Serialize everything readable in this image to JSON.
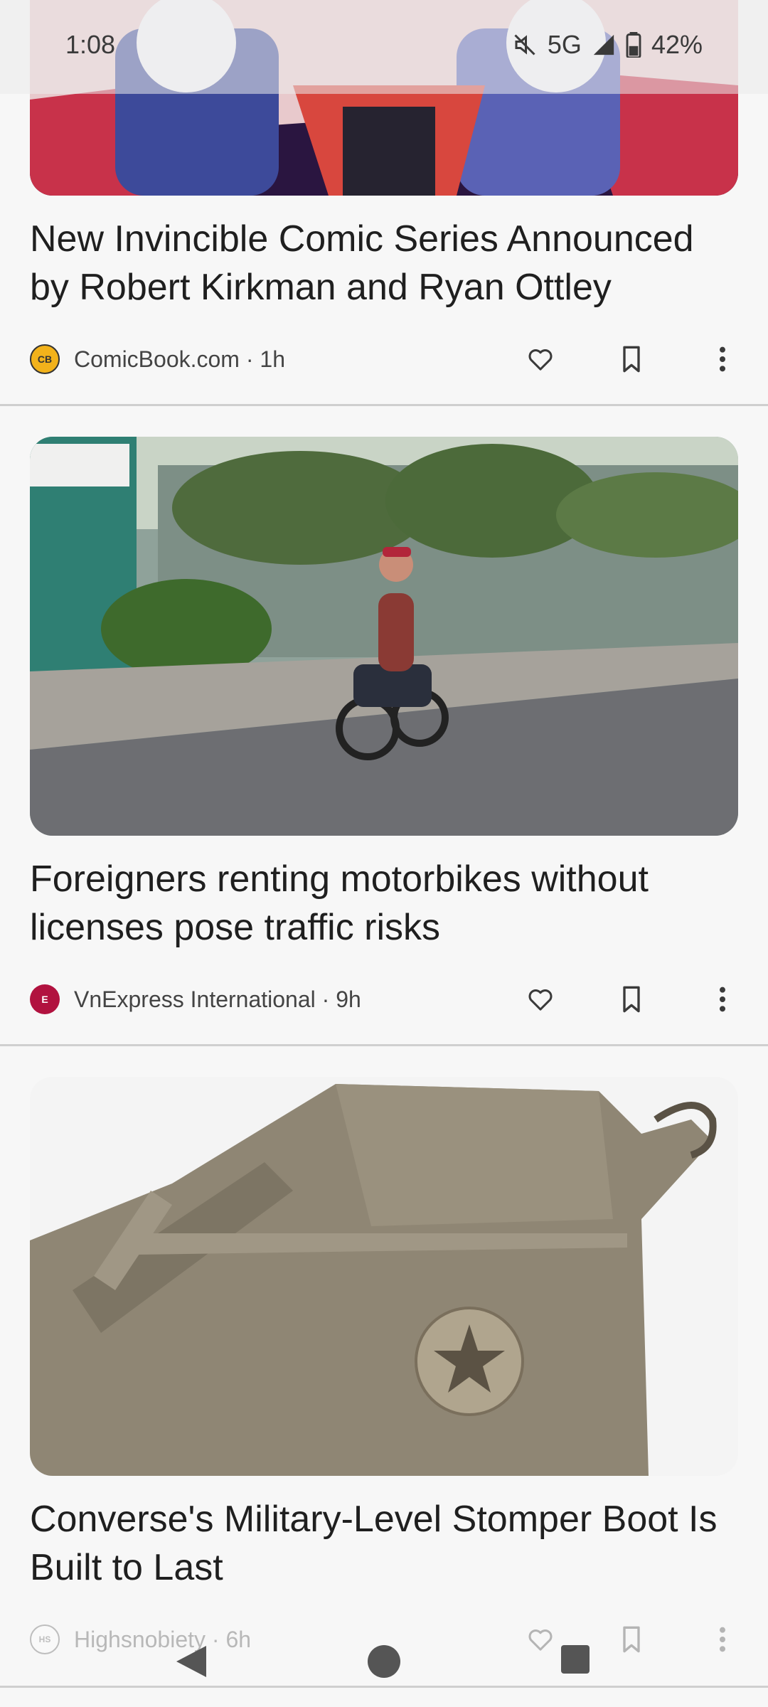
{
  "status": {
    "time": "1:08",
    "network": "5G",
    "battery": "42%",
    "icons": [
      "mute-icon",
      "signal-icon",
      "battery-icon"
    ]
  },
  "articles": [
    {
      "title": "New Invincible Comic Series Announced by Robert Kirkman and Ryan Ottley",
      "source": "ComicBook.com",
      "age": "1h",
      "meta": "ComicBook.com · 1h",
      "logo_text": "CB"
    },
    {
      "title": "Foreigners renting motorbikes without licenses pose traffic risks",
      "source": "VnExpress International",
      "age": "9h",
      "meta": "VnExpress International · 9h",
      "logo_text": "E"
    },
    {
      "title": "Converse's Military-Level Stomper Boot Is Built to Last",
      "source": "Highsnobiety",
      "age": "6h",
      "meta": "Highsnobiety · 6h",
      "logo_text": "HS"
    }
  ],
  "actions": {
    "like_icon": "heart-icon",
    "save_icon": "bookmark-icon",
    "more_icon": "more-vert-icon"
  },
  "nav": {
    "icons": [
      "back-icon",
      "home-icon",
      "recents-icon"
    ]
  },
  "colors": {
    "background": "#f7f7f7",
    "text": "#1f1f1f",
    "comicbook_logo": "#f2b21b",
    "vnexpress_logo": "#b1123f"
  }
}
